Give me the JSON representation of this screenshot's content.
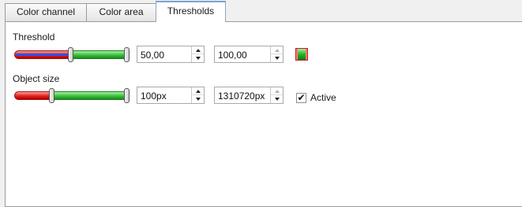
{
  "tabs": [
    {
      "label": "Color channel"
    },
    {
      "label": "Color area"
    },
    {
      "label": "Thresholds"
    }
  ],
  "active_tab": "Thresholds",
  "threshold": {
    "label": "Threshold",
    "min_value": "50,00",
    "max_value": "100,00",
    "slider_low_fraction": 0.5,
    "slider_high_fraction": 1.0,
    "swatch_colors": [
      "#26b426",
      "#ff4040"
    ]
  },
  "object_size": {
    "label": "Object size",
    "min_value": "100px",
    "max_value": "1310720px",
    "slider_low_fraction": 0.3,
    "slider_high_fraction": 1.0,
    "active_label": "Active",
    "active_checked": true
  },
  "icons": {
    "spin_up": "arrow-up-icon",
    "spin_down": "arrow-down-icon",
    "check": "checkmark-icon"
  }
}
